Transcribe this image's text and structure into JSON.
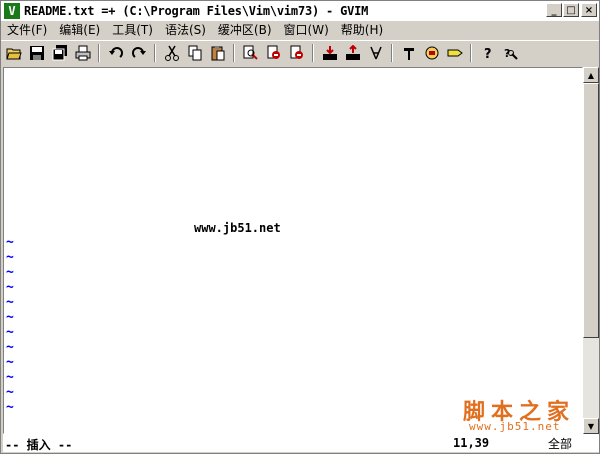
{
  "window": {
    "app_icon": "vim-icon",
    "title": "README.txt =+ (C:\\Program Files\\Vim\\vim73) - GVIM",
    "buttons": {
      "minimize": "_",
      "maximize": "□",
      "close": "×"
    }
  },
  "menu": {
    "items": [
      {
        "label": "文件(F)"
      },
      {
        "label": "编辑(E)"
      },
      {
        "label": "工具(T)"
      },
      {
        "label": "语法(S)"
      },
      {
        "label": "缓冲区(B)"
      },
      {
        "label": "窗口(W)"
      },
      {
        "label": "帮助(H)"
      }
    ]
  },
  "toolbar": {
    "icons": [
      "open-icon",
      "save-icon",
      "save-all-icon",
      "print-icon",
      "undo-icon",
      "redo-icon",
      "cut-icon",
      "copy-icon",
      "paste-icon",
      "find-replace-icon",
      "find-next-icon",
      "find-prev-icon",
      "load-session-icon",
      "save-session-icon",
      "run-script-icon",
      "make-icon",
      "shell-icon",
      "ctags-icon",
      "help-icon",
      "find-help-icon"
    ]
  },
  "editor": {
    "text": "www.jb51.net",
    "tilde_char": "~",
    "tilde_count": 12
  },
  "status": {
    "mode": "-- 插入 --",
    "position": "11,39",
    "scroll": "全部"
  },
  "watermark": {
    "logo": "脚本之家",
    "url": "www.jb51.net"
  },
  "colors": {
    "tilde": "#0000ff",
    "chrome": "#d4d0c8",
    "watermark": "#e07020"
  }
}
